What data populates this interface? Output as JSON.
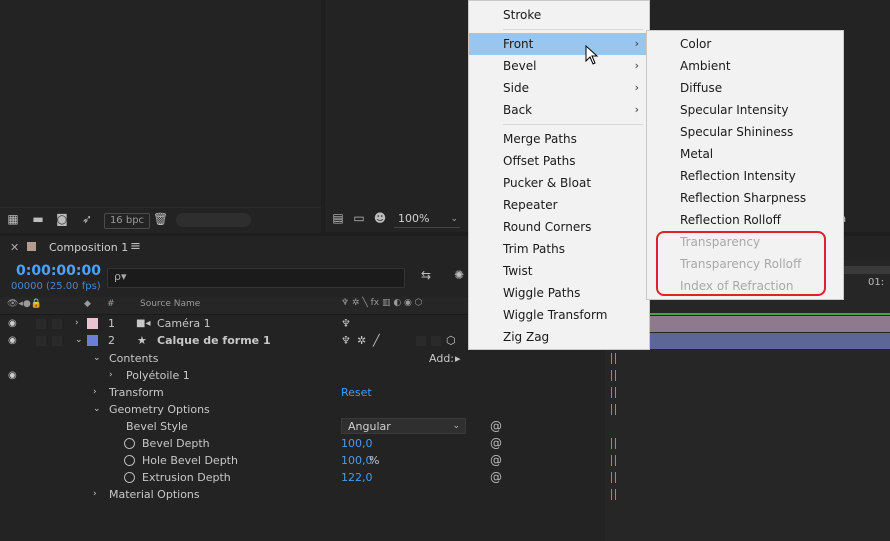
{
  "project_toolbar": {
    "bpc": "16 bpc"
  },
  "comp_toolbar": {
    "zoom": "100%",
    "right_dropdown": "ra"
  },
  "timeline": {
    "tab_title": "Composition 1",
    "timecode": "0:00:00:00",
    "frames": "00000 (25.00 fps)",
    "search_placeholder": "ρ▾",
    "columns": {
      "num": "#",
      "source_name": "Source Name"
    },
    "ruler_label": "01:"
  },
  "layers": [
    {
      "num": "1",
      "name": "Caméra 1",
      "color": "#e8c3d2"
    },
    {
      "num": "2",
      "name": "Calque de forme 1",
      "color": "#6a7fd8"
    }
  ],
  "props": {
    "contents": "Contents",
    "add_label": "Add:",
    "polystar": "Polyétoile 1",
    "transform": "Transform",
    "reset": "Reset",
    "geometry": "Geometry Options",
    "bevel_style": "Bevel Style",
    "bevel_style_value": "Angular",
    "bevel_depth": "Bevel Depth",
    "bevel_depth_value": "100,0",
    "hole_bevel_depth": "Hole Bevel Depth",
    "hole_bevel_depth_value": "100,0",
    "hole_bevel_unit": "%",
    "extrusion_depth": "Extrusion Depth",
    "extrusion_depth_value": "122,0",
    "material": "Material Options"
  },
  "menu": {
    "stroke": "Stroke",
    "front": "Front",
    "bevel": "Bevel",
    "side": "Side",
    "back": "Back",
    "items": [
      "Merge Paths",
      "Offset Paths",
      "Pucker & Bloat",
      "Repeater",
      "Round Corners",
      "Trim Paths",
      "Twist",
      "Wiggle Paths",
      "Wiggle Transform",
      "Zig Zag"
    ]
  },
  "submenu": {
    "enabled": [
      "Color",
      "Ambient",
      "Diffuse",
      "Specular Intensity",
      "Specular Shininess",
      "Metal",
      "Reflection Intensity",
      "Reflection Sharpness",
      "Reflection Rolloff"
    ],
    "disabled": [
      "Transparency",
      "Transparency Rolloff",
      "Index of Refraction"
    ]
  },
  "colors": {
    "highlight": "#99c6ef",
    "annotation": "#e0202a",
    "timecode": "#4aa3ff"
  }
}
